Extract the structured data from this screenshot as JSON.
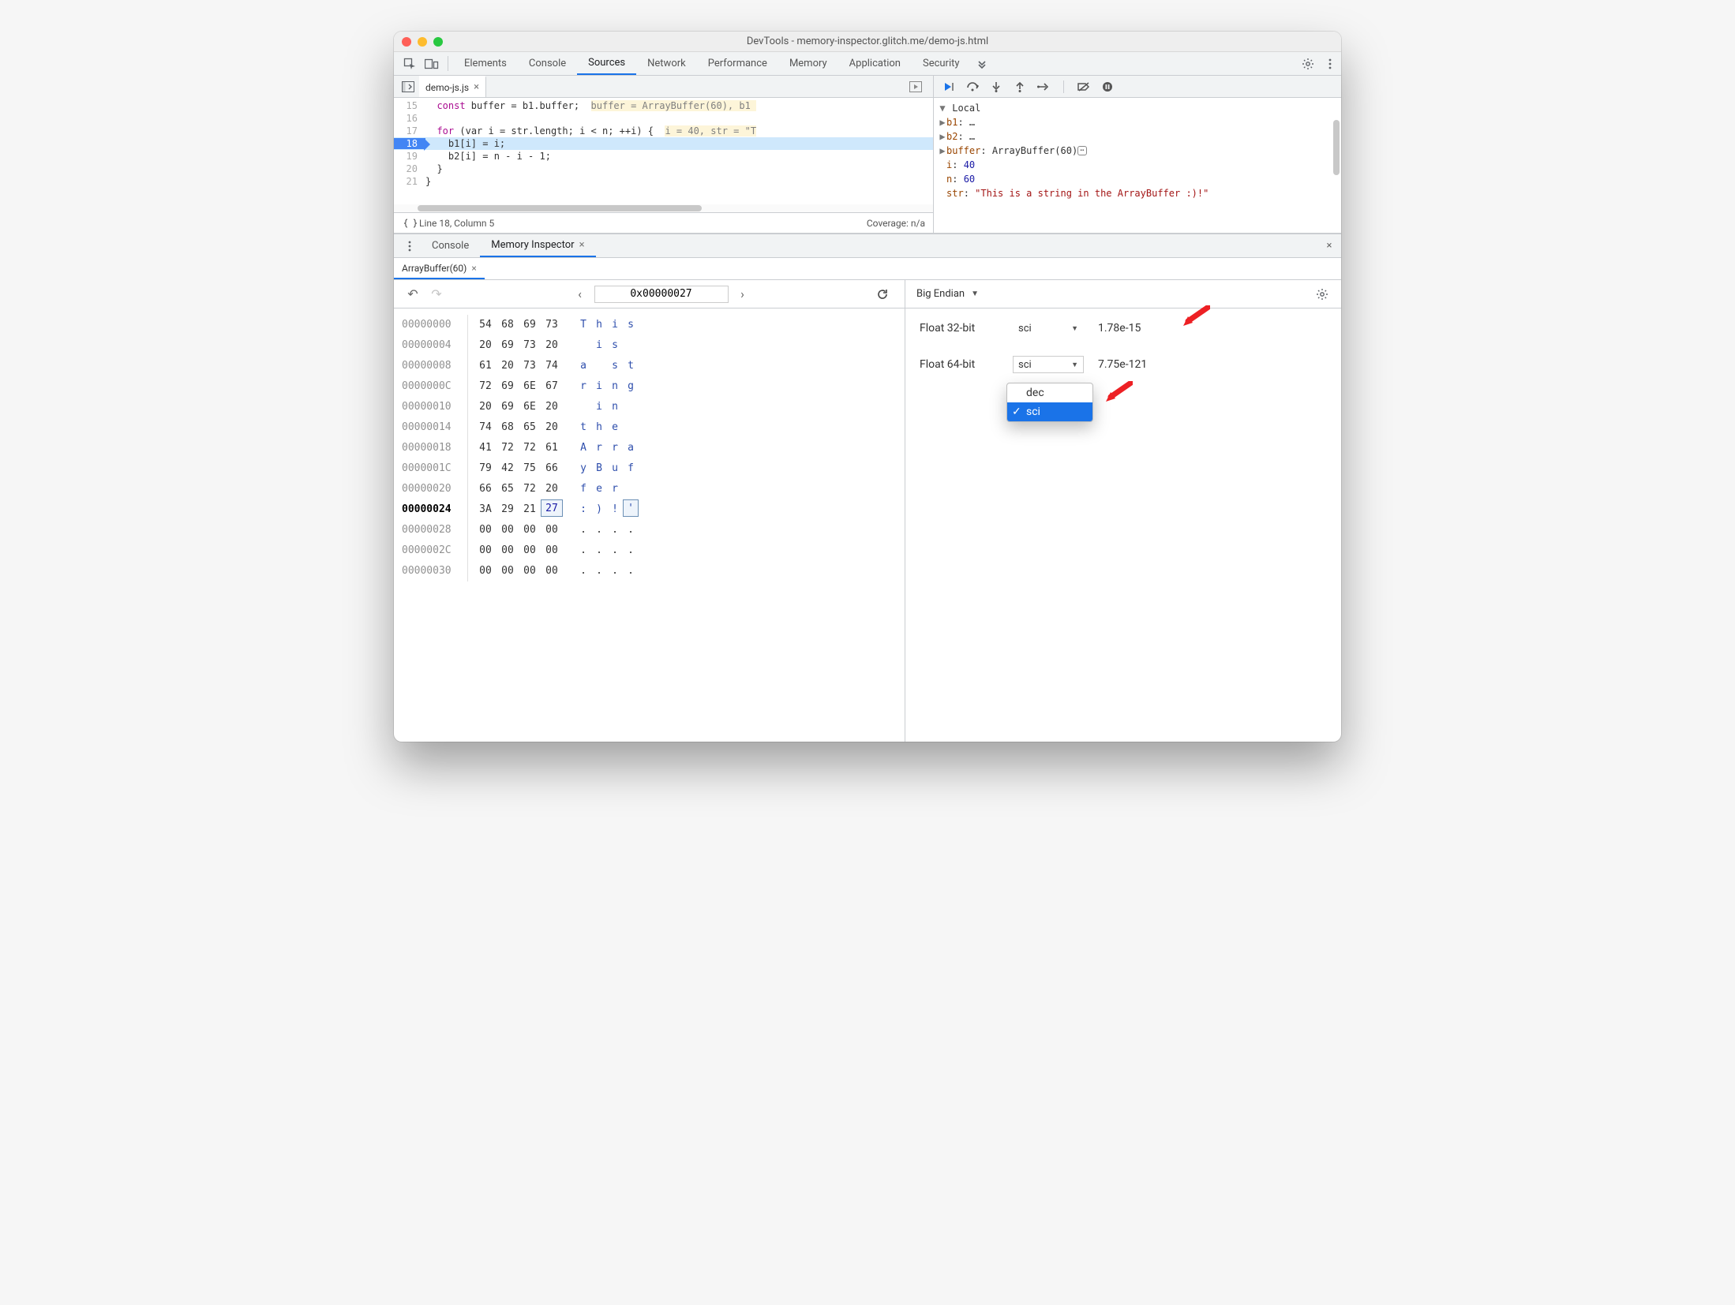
{
  "title": "DevTools - memory-inspector.glitch.me/demo-js.html",
  "tabs": [
    "Elements",
    "Console",
    "Sources",
    "Network",
    "Performance",
    "Memory",
    "Application",
    "Security"
  ],
  "activeTab": "Sources",
  "file": {
    "name": "demo-js.js"
  },
  "code": {
    "lines": [
      {
        "n": 15,
        "pre": "  ",
        "k": "const",
        "rest": " buffer = b1.buffer;  ",
        "hint": "buffer = ArrayBuffer(60), b1 "
      },
      {
        "n": 16,
        "pre": "",
        "rest": ""
      },
      {
        "n": 17,
        "pre": "  ",
        "k": "for",
        "rest": " (var i = str.length; i < n; ++i) {  ",
        "hint": "i = 40, str = \"T"
      },
      {
        "n": 18,
        "pre": "    ",
        "rest": "b1[i] = i;",
        "current": true
      },
      {
        "n": 19,
        "pre": "    ",
        "rest": "b2[i] = n - i - 1;"
      },
      {
        "n": 20,
        "pre": "  ",
        "rest": "}"
      },
      {
        "n": 21,
        "pre": "",
        "rest": "}"
      }
    ]
  },
  "status": {
    "pos": "Line 18, Column 5",
    "coverage": "Coverage: n/a"
  },
  "scope": {
    "header": "Local",
    "items": [
      {
        "name": "b1",
        "value": "…",
        "type": "obj",
        "exp": true
      },
      {
        "name": "b2",
        "value": "…",
        "type": "obj",
        "exp": true
      },
      {
        "name": "buffer",
        "value": "ArrayBuffer(60)",
        "type": "obj",
        "exp": true,
        "mem": true
      },
      {
        "name": "i",
        "value": "40",
        "type": "num"
      },
      {
        "name": "n",
        "value": "60",
        "type": "num"
      },
      {
        "name": "str",
        "value": "\"This is a string in the ArrayBuffer :)!\"",
        "type": "str"
      }
    ]
  },
  "drawer": {
    "tabs": [
      "Console",
      "Memory Inspector"
    ],
    "active": "Memory Inspector",
    "buffer": "ArrayBuffer(60)"
  },
  "hex": {
    "address": "0x00000027",
    "rows": [
      {
        "addr": "00000000",
        "b": [
          "54",
          "68",
          "69",
          "73"
        ],
        "a": [
          "T",
          "h",
          "i",
          "s"
        ]
      },
      {
        "addr": "00000004",
        "b": [
          "20",
          "69",
          "73",
          "20"
        ],
        "a": [
          " ",
          "i",
          "s",
          " "
        ]
      },
      {
        "addr": "00000008",
        "b": [
          "61",
          "20",
          "73",
          "74"
        ],
        "a": [
          "a",
          " ",
          "s",
          "t"
        ]
      },
      {
        "addr": "0000000C",
        "b": [
          "72",
          "69",
          "6E",
          "67"
        ],
        "a": [
          "r",
          "i",
          "n",
          "g"
        ]
      },
      {
        "addr": "00000010",
        "b": [
          "20",
          "69",
          "6E",
          "20"
        ],
        "a": [
          " ",
          "i",
          "n",
          " "
        ]
      },
      {
        "addr": "00000014",
        "b": [
          "74",
          "68",
          "65",
          "20"
        ],
        "a": [
          "t",
          "h",
          "e",
          " "
        ]
      },
      {
        "addr": "00000018",
        "b": [
          "41",
          "72",
          "72",
          "61"
        ],
        "a": [
          "A",
          "r",
          "r",
          "a"
        ]
      },
      {
        "addr": "0000001C",
        "b": [
          "79",
          "42",
          "75",
          "66"
        ],
        "a": [
          "y",
          "B",
          "u",
          "f"
        ]
      },
      {
        "addr": "00000020",
        "b": [
          "66",
          "65",
          "72",
          "20"
        ],
        "a": [
          "f",
          "e",
          "r",
          " "
        ]
      },
      {
        "addr": "00000024",
        "b": [
          "3A",
          "29",
          "21",
          "27"
        ],
        "a": [
          ":",
          ")",
          "!",
          "'"
        ],
        "selByte": 3,
        "selCh": 3,
        "hot": true
      },
      {
        "addr": "00000028",
        "b": [
          "00",
          "00",
          "00",
          "00"
        ],
        "a": [
          ".",
          ".",
          ".",
          "."
        ]
      },
      {
        "addr": "0000002C",
        "b": [
          "00",
          "00",
          "00",
          "00"
        ],
        "a": [
          ".",
          ".",
          ".",
          "."
        ]
      },
      {
        "addr": "00000030",
        "b": [
          "00",
          "00",
          "00",
          "00"
        ],
        "a": [
          ".",
          ".",
          ".",
          "."
        ]
      }
    ]
  },
  "values": {
    "endian": "Big Endian",
    "rows": [
      {
        "label": "Float 32-bit",
        "mode": "sci",
        "value": "1.78e-15"
      },
      {
        "label": "Float 64-bit",
        "mode": "sci",
        "value": "7.75e-121"
      }
    ],
    "menu": [
      "dec",
      "sci"
    ],
    "menuSelected": "sci"
  }
}
